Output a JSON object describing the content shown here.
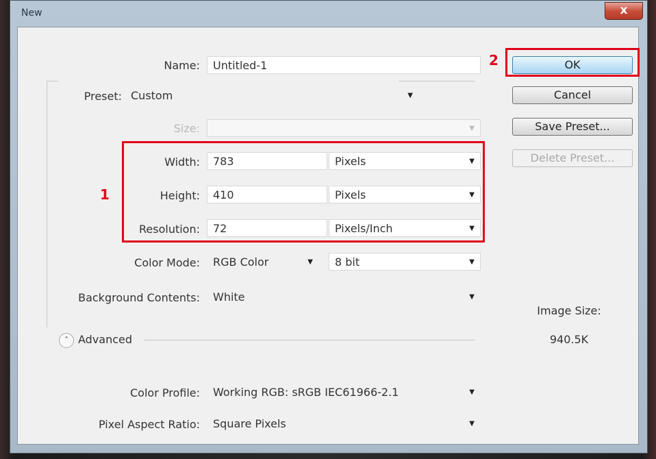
{
  "window": {
    "title": "New",
    "close_label": "x"
  },
  "name": {
    "label": "Name:",
    "value": "Untitled-1"
  },
  "preset": {
    "label": "Preset:",
    "value": "Custom"
  },
  "size": {
    "label": "Size:",
    "value": ""
  },
  "width": {
    "label": "Width:",
    "value": "783",
    "unit": "Pixels"
  },
  "height": {
    "label": "Height:",
    "value": "410",
    "unit": "Pixels"
  },
  "resolution": {
    "label": "Resolution:",
    "value": "72",
    "unit": "Pixels/Inch"
  },
  "color_mode": {
    "label": "Color Mode:",
    "value": "RGB Color",
    "depth": "8 bit"
  },
  "background": {
    "label": "Background Contents:",
    "value": "White"
  },
  "advanced": {
    "label": "Advanced"
  },
  "color_profile": {
    "label": "Color Profile:",
    "value": "Working RGB:  sRGB IEC61966-2.1"
  },
  "pixel_aspect": {
    "label": "Pixel Aspect Ratio:",
    "value": "Square Pixels"
  },
  "buttons": {
    "ok": "OK",
    "cancel": "Cancel",
    "save_preset": "Save Preset...",
    "delete_preset": "Delete Preset..."
  },
  "image_size": {
    "label": "Image Size:",
    "value": "940.5K"
  },
  "annotations": {
    "marker1": "1",
    "marker2": "2",
    "highlight_color": "#e0001a"
  }
}
